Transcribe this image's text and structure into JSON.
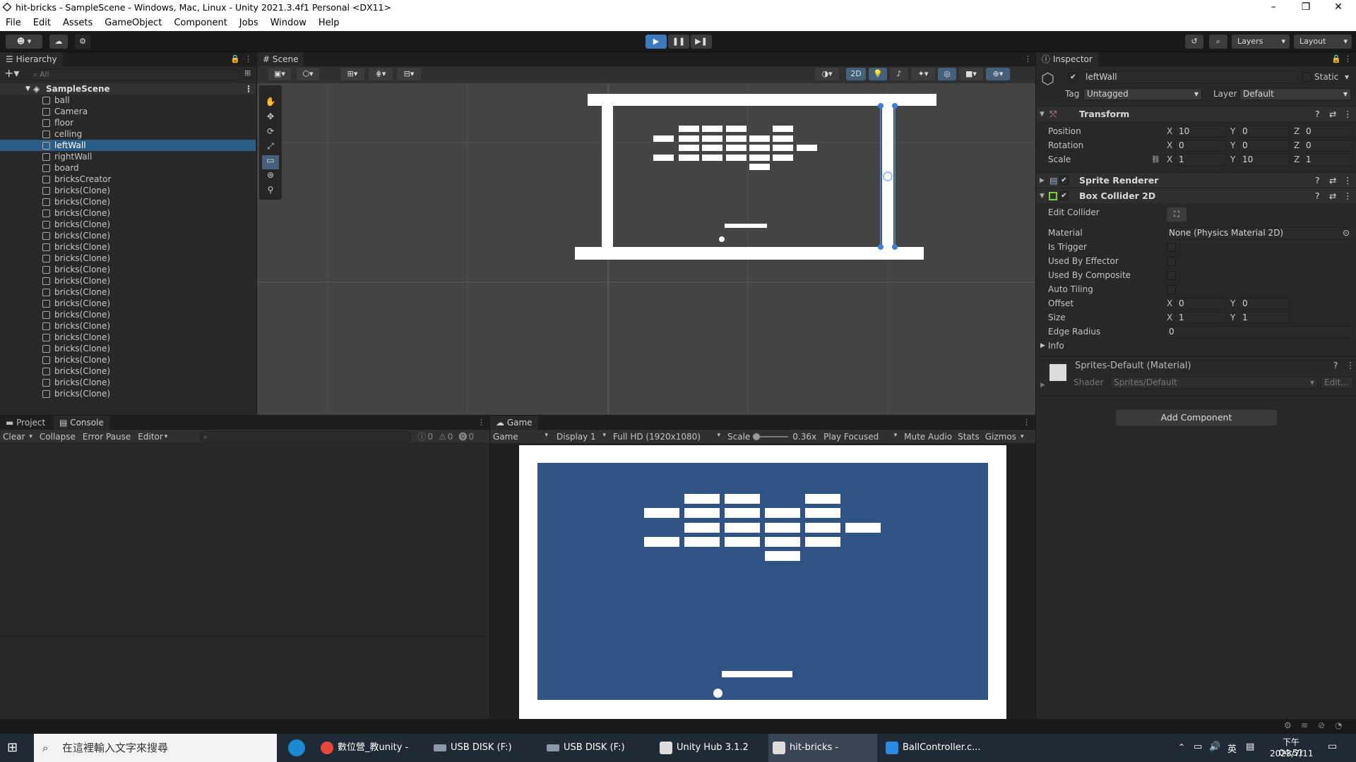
{
  "window": {
    "title": "hit-bricks - SampleScene - Windows, Mac, Linux - Unity 2021.3.4f1 Personal <DX11>"
  },
  "menu": [
    "File",
    "Edit",
    "Assets",
    "GameObject",
    "Component",
    "Jobs",
    "Window",
    "Help"
  ],
  "toolbar": {
    "layers_label": "Layers",
    "layout_label": "Layout"
  },
  "hierarchy": {
    "tab": "Hierarchy",
    "search_placeholder": "All",
    "scene": "SampleScene",
    "items": [
      "ball",
      "Camera",
      "floor",
      "celling",
      "leftWall",
      "rightWall",
      "board",
      "bricksCreator",
      "bricks(Clone)",
      "bricks(Clone)",
      "bricks(Clone)",
      "bricks(Clone)",
      "bricks(Clone)",
      "bricks(Clone)",
      "bricks(Clone)",
      "bricks(Clone)",
      "bricks(Clone)",
      "bricks(Clone)",
      "bricks(Clone)",
      "bricks(Clone)",
      "bricks(Clone)",
      "bricks(Clone)",
      "bricks(Clone)",
      "bricks(Clone)",
      "bricks(Clone)",
      "bricks(Clone)",
      "bricks(Clone)"
    ],
    "selected_index": 4
  },
  "scene_view": {
    "tab": "Scene",
    "mode_2d": "2D"
  },
  "inspector": {
    "tab": "Inspector",
    "object_name": "leftWall",
    "static_label": "Static",
    "tag_label": "Tag",
    "tag_value": "Untagged",
    "layer_label": "Layer",
    "layer_value": "Default",
    "transform": {
      "title": "Transform",
      "position_label": "Position",
      "position": {
        "x": "10",
        "y": "0",
        "z": "0"
      },
      "rotation_label": "Rotation",
      "rotation": {
        "x": "0",
        "y": "0",
        "z": "0"
      },
      "scale_label": "Scale",
      "scale": {
        "x": "1",
        "y": "10",
        "z": "1"
      }
    },
    "sprite_renderer": "Sprite Renderer",
    "box_collider": {
      "title": "Box Collider 2D",
      "edit_collider": "Edit Collider",
      "material_label": "Material",
      "material_value": "None (Physics Material 2D)",
      "is_trigger": "Is Trigger",
      "used_by_effector": "Used By Effector",
      "used_by_composite": "Used By Composite",
      "auto_tiling": "Auto Tiling",
      "offset_label": "Offset",
      "offset": {
        "x": "0",
        "y": "0"
      },
      "size_label": "Size",
      "size": {
        "x": "1",
        "y": "1"
      },
      "edge_radius_label": "Edge Radius",
      "edge_radius": "0",
      "info": "Info"
    },
    "material": {
      "name": "Sprites-Default (Material)",
      "shader_label": "Shader",
      "shader_value": "Sprites/Default",
      "edit": "Edit..."
    },
    "add_component": "Add Component"
  },
  "project_console": {
    "tab_project": "Project",
    "tab_console": "Console",
    "clear": "Clear",
    "collapse": "Collapse",
    "error_pause": "Error Pause",
    "editor": "Editor",
    "count_log": "0",
    "count_warn": "0",
    "count_err": "0"
  },
  "game_view": {
    "tab": "Game",
    "mode": "Game",
    "display": "Display 1",
    "resolution": "Full HD (1920x1080)",
    "scale_label": "Scale",
    "scale_value": "0.36x",
    "play_focused": "Play Focused",
    "mute_audio": "Mute Audio",
    "stats": "Stats",
    "gizmos": "Gizmos",
    "bg_color": "#2f5384"
  },
  "taskbar": {
    "search_placeholder": "在這裡輸入文字來搜尋",
    "apps": [
      "數位營_教unity - G...",
      "USB DISK (F:)",
      "USB DISK (F:)",
      "Unity Hub 3.1.2",
      "hit-bricks - Sampl...",
      "BallController.c..."
    ],
    "time": "下午 04:51",
    "date": "2023/7/11",
    "ime": "英"
  }
}
